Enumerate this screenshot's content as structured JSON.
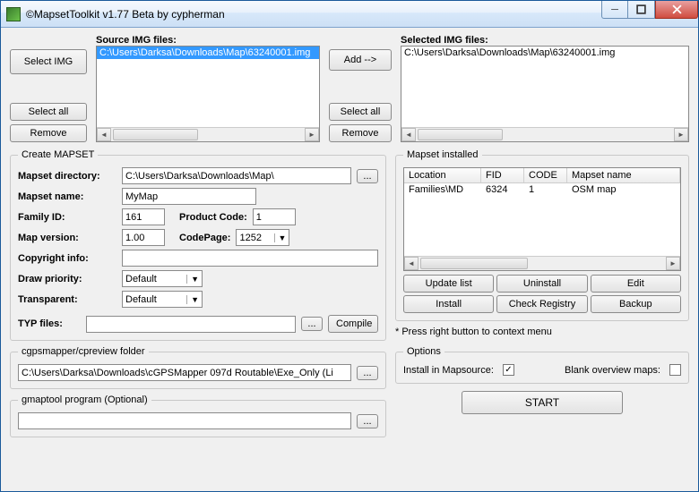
{
  "window": {
    "title": "©MapsetToolkit v1.77 Beta by cypherman"
  },
  "win_buttons": {
    "min": "–",
    "max": "▢",
    "close": "✕"
  },
  "top": {
    "select_img": "Select IMG",
    "source_label": "Source IMG files:",
    "selected_label": "Selected IMG files:",
    "add_btn": "Add -->",
    "select_all": "Select all",
    "remove": "Remove",
    "source_items": [
      "C:\\Users\\Darksa\\Downloads\\Map\\63240001.img"
    ],
    "selected_items": [
      "C:\\Users\\Darksa\\Downloads\\Map\\63240001.img"
    ]
  },
  "create": {
    "legend": "Create MAPSET",
    "mapset_dir_label": "Mapset directory:",
    "mapset_dir": "C:\\Users\\Darksa\\Downloads\\Map\\",
    "browse": "...",
    "mapset_name_label": "Mapset name:",
    "mapset_name": "MyMap",
    "family_id_label": "Family ID:",
    "family_id": "161",
    "product_code_label": "Product Code:",
    "product_code": "1",
    "map_version_label": "Map version:",
    "map_version": "1.00",
    "codepage_label": "CodePage:",
    "codepage": "1252",
    "copyright_label": "Copyright info:",
    "copyright": "",
    "draw_priority_label": "Draw priority:",
    "draw_priority": "Default",
    "transparent_label": "Transparent:",
    "transparent": "Default",
    "typ_label": "TYP files:",
    "typ": "",
    "compile": "Compile"
  },
  "installed": {
    "legend": "Mapset installed",
    "headers": {
      "location": "Location",
      "fid": "FID",
      "code": "CODE",
      "name": "Mapset name"
    },
    "rows": [
      {
        "location": "Families\\MD",
        "fid": "6324",
        "code": "1",
        "name": "OSM map"
      }
    ],
    "update_list": "Update list",
    "uninstall": "Uninstall",
    "edit": "Edit",
    "install": "Install",
    "check_registry": "Check Registry",
    "backup": "Backup",
    "hint": "* Press right button to context menu"
  },
  "cgps": {
    "legend": "cgpsmapper/cpreview folder",
    "path": "C:\\Users\\Darksa\\Downloads\\cGPSMapper 097d Routable\\Exe_Only (Li",
    "browse": "..."
  },
  "gmap": {
    "legend": "gmaptool program (Optional)",
    "path": "",
    "browse": "..."
  },
  "options": {
    "legend": "Options",
    "install_in_mapsource": "Install in Mapsource:",
    "install_checked": true,
    "blank_overview": "Blank overview maps:",
    "blank_checked": false
  },
  "start": "START"
}
